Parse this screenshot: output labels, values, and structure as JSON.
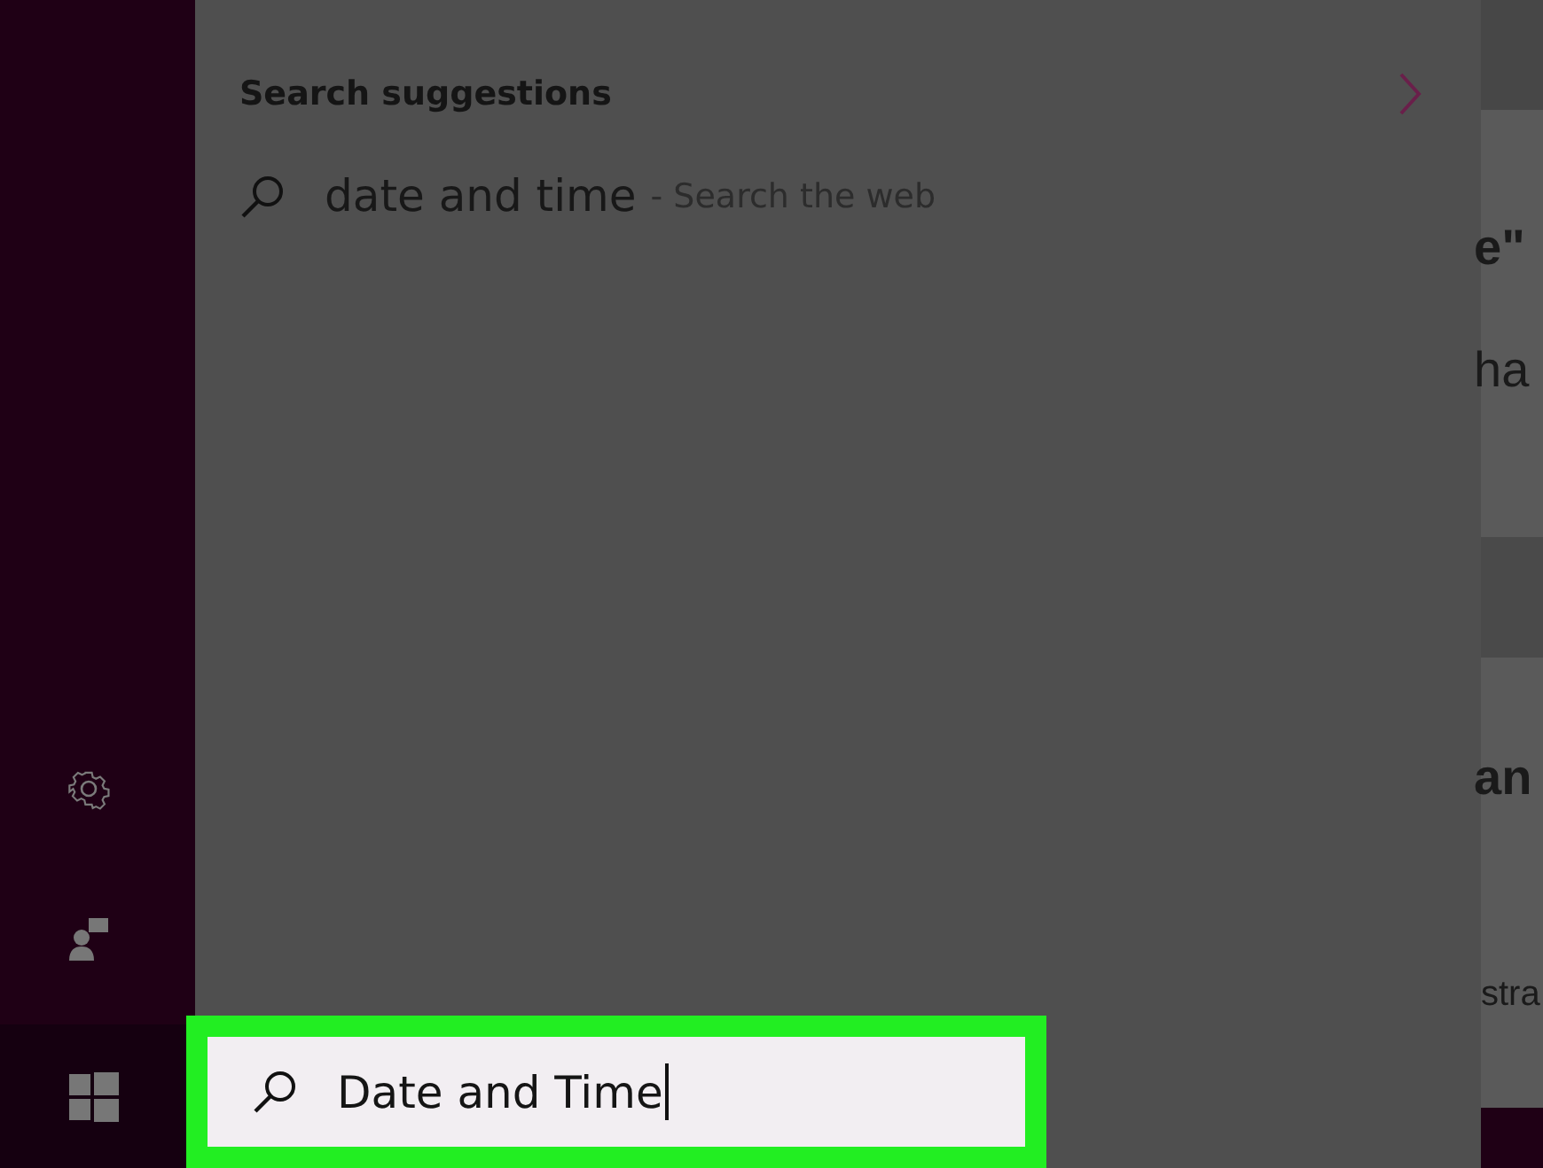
{
  "search_panel": {
    "heading": "Search suggestions",
    "suggestions": [
      {
        "query": "date and time",
        "source": "- Search the web"
      }
    ]
  },
  "search_box": {
    "value": "Date and Time",
    "highlighted": true
  },
  "background_page": {
    "fragments": [
      {
        "text": "e\""
      },
      {
        "text": "ha"
      },
      {
        "text": "an"
      },
      {
        "text": "stra"
      }
    ]
  }
}
